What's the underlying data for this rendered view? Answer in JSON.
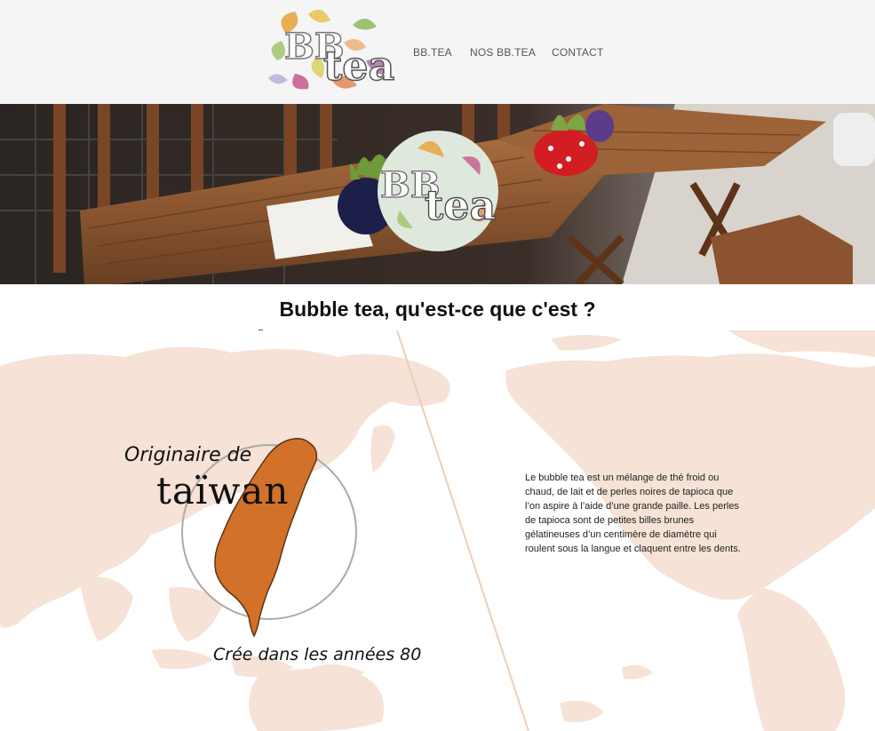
{
  "header": {
    "logo_text_bb": "BB",
    "logo_text_tea": "tea",
    "nav": [
      {
        "label": "BB.TEA"
      },
      {
        "label": "NOS BB.TEA"
      },
      {
        "label": "CONTACT"
      }
    ]
  },
  "banner": {
    "logo_bb": "BB",
    "logo_tea": "tea"
  },
  "main": {
    "title": "Bubble tea, qu'est-ce que c'est ?",
    "origin_line1": "Originaire de",
    "origin_line2": "taïwan",
    "created": "Crée dans les années 80",
    "description": "Le bubble tea est un mélange de thé froid ou chaud, de lait et de perles noires de tapioca que l’on aspire à l’aide d’une grande paille. Les perles de tapioca sont de petites billes brunes gélatineuses d’un centimère de diamètre qui roulent sous la langue et claquent entre les dents."
  },
  "colors": {
    "header_bg": "#f5f5f5",
    "map_land": "#f6e2d6",
    "taiwan_fill": "#d2712a",
    "circle_stroke": "#aaaaaa"
  }
}
